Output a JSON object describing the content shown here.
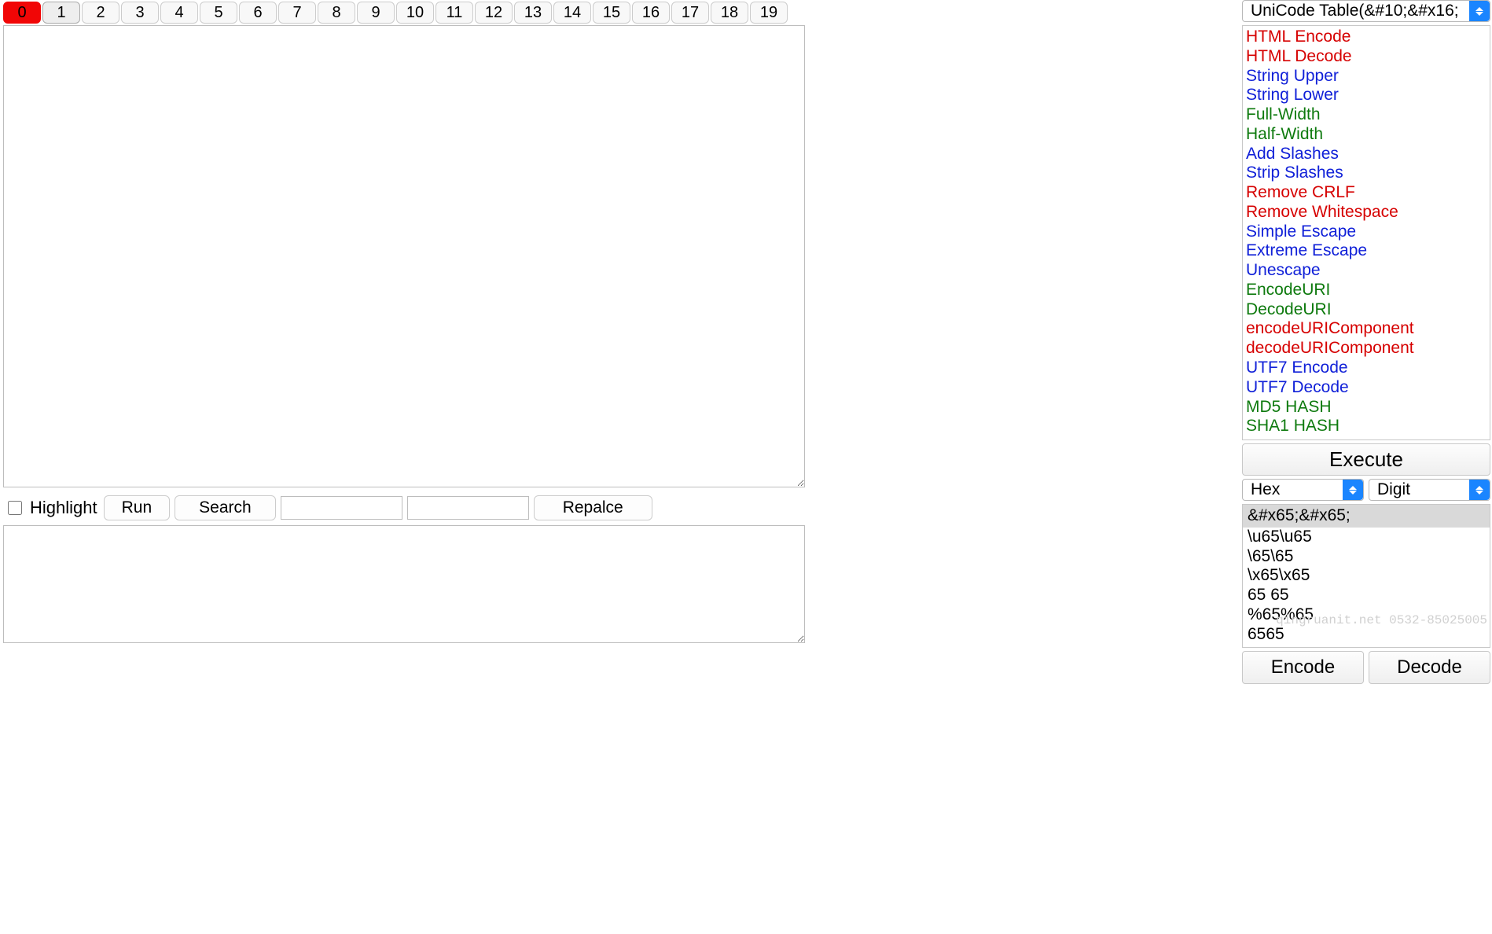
{
  "tabs": [
    "0",
    "1",
    "2",
    "3",
    "4",
    "5",
    "6",
    "7",
    "8",
    "9",
    "10",
    "11",
    "12",
    "13",
    "14",
    "15",
    "16",
    "17",
    "18",
    "19"
  ],
  "active_tab_index": 0,
  "selected_tab_index": 1,
  "main_textarea_value": "",
  "controls": {
    "highlight_label": "Highlight",
    "highlight_checked": false,
    "run_label": "Run",
    "search_label": "Search",
    "search_value": "",
    "replace_with_value": "",
    "replace_label": "Repalce"
  },
  "output_textarea_value": "",
  "right": {
    "top_selector_value": "UniCode Table(&#10;&#x16;",
    "functions": [
      {
        "label": "HTML Encode",
        "color": "red"
      },
      {
        "label": "HTML Decode",
        "color": "red"
      },
      {
        "label": "String Upper",
        "color": "blue"
      },
      {
        "label": "String Lower",
        "color": "blue"
      },
      {
        "label": "Full-Width",
        "color": "green"
      },
      {
        "label": "Half-Width",
        "color": "green"
      },
      {
        "label": "Add Slashes",
        "color": "blue"
      },
      {
        "label": "Strip Slashes",
        "color": "blue"
      },
      {
        "label": "Remove CRLF",
        "color": "red"
      },
      {
        "label": "Remove Whitespace",
        "color": "red"
      },
      {
        "label": "Simple Escape",
        "color": "blue"
      },
      {
        "label": "Extreme Escape",
        "color": "blue"
      },
      {
        "label": "Unescape",
        "color": "blue"
      },
      {
        "label": "EncodeURI",
        "color": "green"
      },
      {
        "label": "DecodeURI",
        "color": "green"
      },
      {
        "label": "encodeURIComponent",
        "color": "red"
      },
      {
        "label": "decodeURIComponent",
        "color": "red"
      },
      {
        "label": "UTF7 Encode",
        "color": "blue"
      },
      {
        "label": "UTF7 Decode",
        "color": "blue"
      },
      {
        "label": "MD5 HASH",
        "color": "green"
      },
      {
        "label": "SHA1 HASH",
        "color": "green"
      }
    ],
    "execute_label": "Execute",
    "format_selector_value": "Hex",
    "base_selector_value": "Digit",
    "code_lines": [
      "&#x65;&#x65;",
      "\\u65\\u65",
      "\\65\\65",
      "\\x65\\x65",
      "65 65",
      "%65%65",
      "6565"
    ],
    "encode_label": "Encode",
    "decode_label": "Decode"
  },
  "watermark": "qingruanit.net 0532-85025005"
}
